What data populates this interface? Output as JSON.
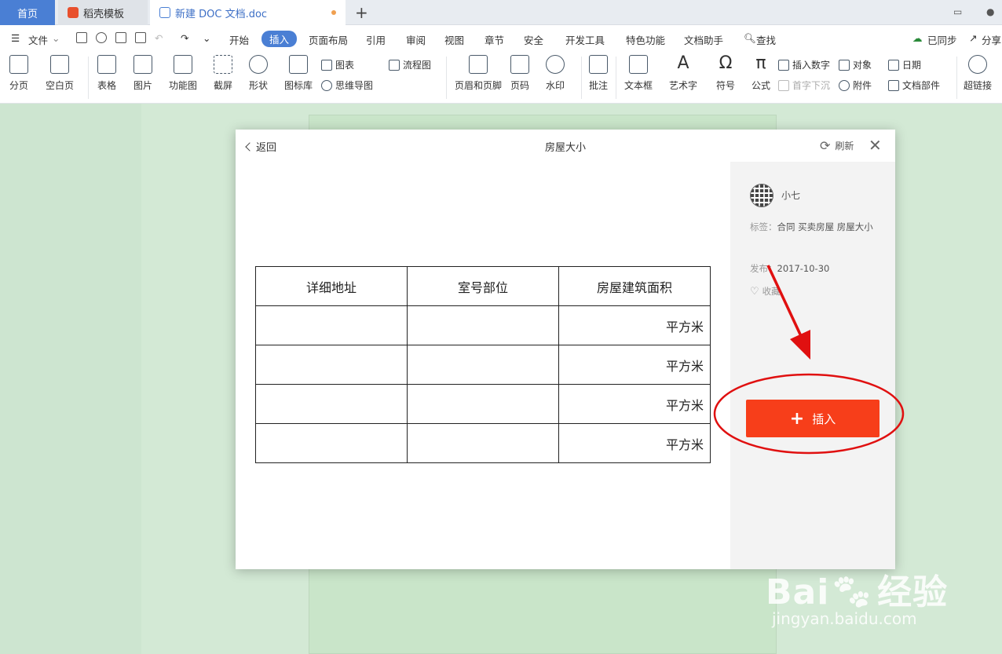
{
  "tabs": {
    "home": "首页",
    "docer": "稻壳模板",
    "doc": "新建 DOC 文档.doc",
    "add": "+"
  },
  "menubar": {
    "file": "文件",
    "items": [
      "开始",
      "插入",
      "页面布局",
      "引用",
      "审阅",
      "视图",
      "章节",
      "安全",
      "开发工具",
      "特色功能",
      "文档助手",
      "查找"
    ],
    "active": "插入",
    "sync": "已同步",
    "share": "分享"
  },
  "ribbon": {
    "large": [
      "分页",
      "空白页",
      "表格",
      "图片",
      "功能图",
      "截屏",
      "形状",
      "图标库",
      "页眉和页脚",
      "页码",
      "水印",
      "批注",
      "文本框",
      "艺术字",
      "符号",
      "公式",
      "超链接"
    ],
    "small": {
      "chart": "图表",
      "mindmap": "思维导图",
      "flow": "流程图",
      "insert_num": "插入数字",
      "object": "对象",
      "date": "日期",
      "dropcap": "首字下沉",
      "attach": "附件",
      "doc_parts": "文档部件"
    }
  },
  "dialog": {
    "back": "返回",
    "title": "房屋大小",
    "refresh": "刷新",
    "table": {
      "headers": [
        "详细地址",
        "室号部位",
        "房屋建筑面积"
      ],
      "unit": "平方米"
    },
    "info": {
      "author": "小七",
      "tags_label": "标签：",
      "tags": "合同  买卖房屋  房屋大小",
      "publish_label": "发布：",
      "publish_date": "2017-10-30",
      "favorite": "收藏",
      "insert": "插入"
    }
  },
  "watermark": {
    "brand": "Bai",
    "brand2": "经验",
    "url": "jingyan.baidu.com"
  },
  "colors": {
    "accent": "#4a7fd4",
    "insert_button": "#f73e1a",
    "annotation": "#e01010"
  }
}
